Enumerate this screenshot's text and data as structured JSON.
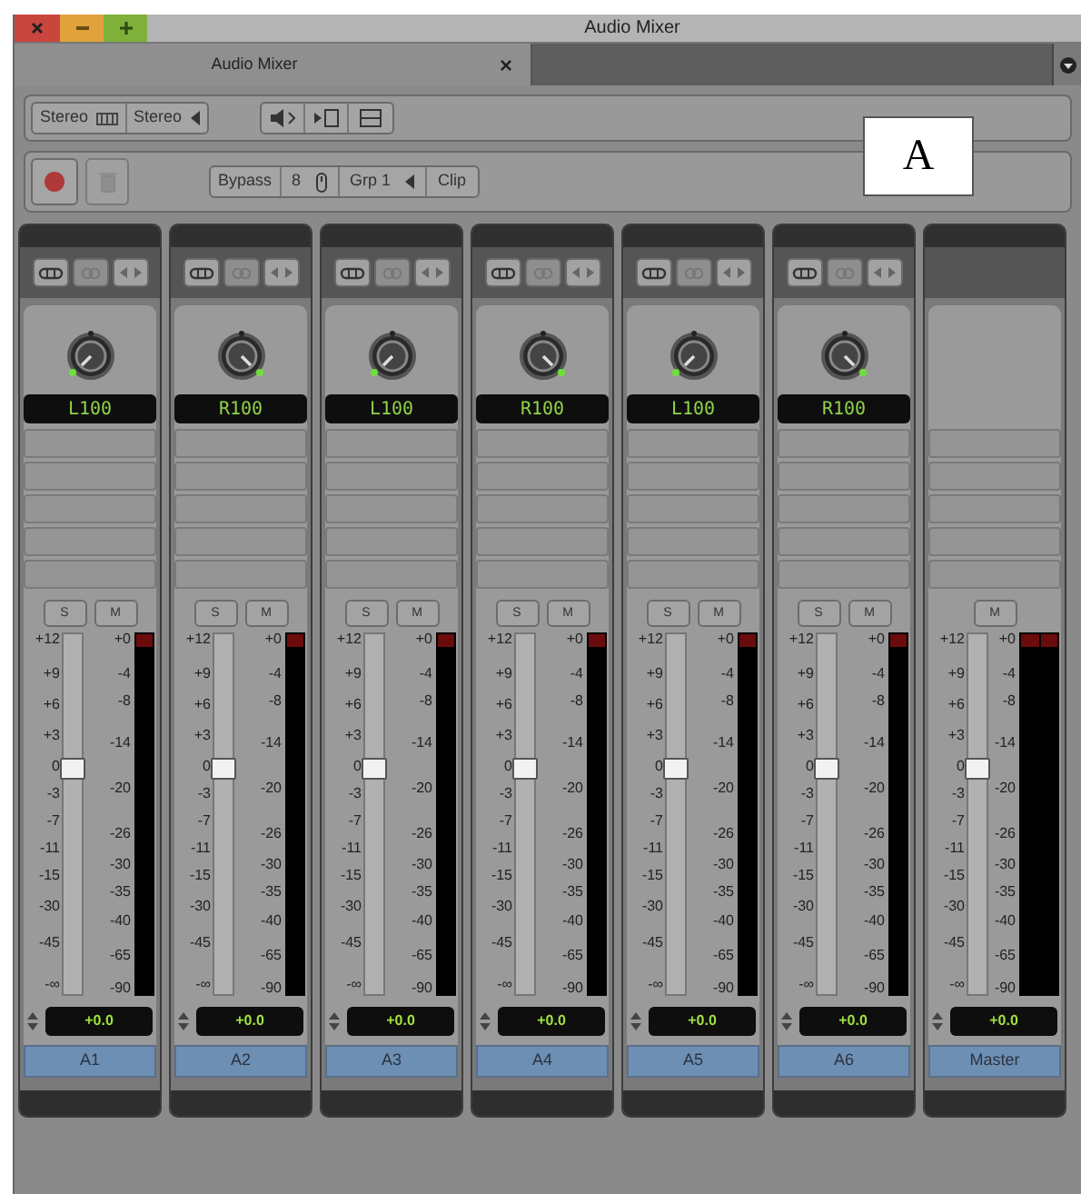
{
  "window": {
    "title": "Audio Mixer"
  },
  "tab": {
    "label": "Audio Mixer",
    "close": "×"
  },
  "toolbar_1": {
    "format_buttons": [
      "Stereo",
      "Stereo"
    ]
  },
  "toolbar_2": {
    "bank_buttons": [
      "Bypass",
      "8",
      "Grp 1",
      "Clip"
    ]
  },
  "callout": "A",
  "channels": [
    {
      "kind": "track",
      "pan": "L100",
      "panned_left": true,
      "buttons": [
        "S",
        "M"
      ],
      "fader_scale": [
        "+12",
        "+9",
        "+6",
        "+3",
        "0",
        "-3",
        "-7",
        "-11",
        "-15",
        "-30",
        "-45",
        "-∞"
      ],
      "meter_scale": [
        "+0",
        "-4",
        "-8",
        "-14",
        "-20",
        "-26",
        "-30",
        "-35",
        "-40",
        "-65",
        "-90"
      ],
      "fader": {
        "level": 0.63
      },
      "meters": [
        {
          "clip": true
        }
      ],
      "gain": "+0.0",
      "name": "A1"
    },
    {
      "kind": "track",
      "pan": "R100",
      "panned_left": false,
      "buttons": [
        "S",
        "M"
      ],
      "fader_scale": [
        "+12",
        "+9",
        "+6",
        "+3",
        "0",
        "-3",
        "-7",
        "-11",
        "-15",
        "-30",
        "-45",
        "-∞"
      ],
      "meter_scale": [
        "+0",
        "-4",
        "-8",
        "-14",
        "-20",
        "-26",
        "-30",
        "-35",
        "-40",
        "-65",
        "-90"
      ],
      "fader": {
        "level": 0.63
      },
      "meters": [
        {
          "clip": true
        }
      ],
      "gain": "+0.0",
      "name": "A2"
    },
    {
      "kind": "track",
      "pan": "L100",
      "panned_left": true,
      "buttons": [
        "S",
        "M"
      ],
      "fader_scale": [
        "+12",
        "+9",
        "+6",
        "+3",
        "0",
        "-3",
        "-7",
        "-11",
        "-15",
        "-30",
        "-45",
        "-∞"
      ],
      "meter_scale": [
        "+0",
        "-4",
        "-8",
        "-14",
        "-20",
        "-26",
        "-30",
        "-35",
        "-40",
        "-65",
        "-90"
      ],
      "fader": {
        "level": 0.63
      },
      "meters": [
        {
          "clip": true
        }
      ],
      "gain": "+0.0",
      "name": "A3"
    },
    {
      "kind": "track",
      "pan": "R100",
      "panned_left": false,
      "buttons": [
        "S",
        "M"
      ],
      "fader_scale": [
        "+12",
        "+9",
        "+6",
        "+3",
        "0",
        "-3",
        "-7",
        "-11",
        "-15",
        "-30",
        "-45",
        "-∞"
      ],
      "meter_scale": [
        "+0",
        "-4",
        "-8",
        "-14",
        "-20",
        "-26",
        "-30",
        "-35",
        "-40",
        "-65",
        "-90"
      ],
      "fader": {
        "level": 0.63
      },
      "meters": [
        {
          "clip": true
        }
      ],
      "gain": "+0.0",
      "name": "A4"
    },
    {
      "kind": "track",
      "pan": "L100",
      "panned_left": true,
      "buttons": [
        "S",
        "M"
      ],
      "fader_scale": [
        "+12",
        "+9",
        "+6",
        "+3",
        "0",
        "-3",
        "-7",
        "-11",
        "-15",
        "-30",
        "-45",
        "-∞"
      ],
      "meter_scale": [
        "+0",
        "-4",
        "-8",
        "-14",
        "-20",
        "-26",
        "-30",
        "-35",
        "-40",
        "-65",
        "-90"
      ],
      "fader": {
        "level": 0.63
      },
      "meters": [
        {
          "clip": true
        }
      ],
      "gain": "+0.0",
      "name": "A5"
    },
    {
      "kind": "track",
      "pan": "R100",
      "panned_left": false,
      "buttons": [
        "S",
        "M"
      ],
      "fader_scale": [
        "+12",
        "+9",
        "+6",
        "+3",
        "0",
        "-3",
        "-7",
        "-11",
        "-15",
        "-30",
        "-45",
        "-∞"
      ],
      "meter_scale": [
        "+0",
        "-4",
        "-8",
        "-14",
        "-20",
        "-26",
        "-30",
        "-35",
        "-40",
        "-65",
        "-90"
      ],
      "fader": {
        "level": 0.63
      },
      "meters": [
        {
          "clip": true
        }
      ],
      "gain": "+0.0",
      "name": "A6"
    },
    {
      "kind": "master",
      "buttons": [
        "M"
      ],
      "fader_scale": [
        "+12",
        "+9",
        "+6",
        "+3",
        "0",
        "-3",
        "-7",
        "-11",
        "-15",
        "-30",
        "-45",
        "-∞"
      ],
      "meter_scale": [
        "+0",
        "-4",
        "-8",
        "-14",
        "-20",
        "-26",
        "-30",
        "-35",
        "-40",
        "-65",
        "-90"
      ],
      "fader": {
        "level": 0.63
      },
      "meters": [
        {
          "clip": true
        },
        {
          "clip": true
        }
      ],
      "gain": "+0.0",
      "name": "Master"
    }
  ]
}
